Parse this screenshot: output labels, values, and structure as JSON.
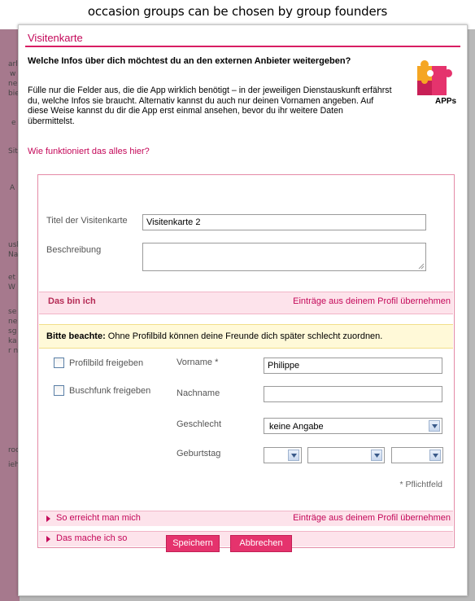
{
  "background": {
    "caption": "occasion groups can be chosen by group founders",
    "left_strip_texts": [
      "arl",
      "w",
      "nei",
      "bie",
      "e",
      "Site",
      "A",
      "usl",
      "Na",
      "et",
      "W",
      "se",
      "ne",
      "sg",
      "ka",
      "r n",
      "roc",
      "ieh"
    ],
    "accent_color": "#9a4f6f"
  },
  "dialog": {
    "title": "Visitenkarte",
    "heading": "Welche Infos über dich möchtest du an den externen Anbieter weitergeben?",
    "intro": "Fülle nur die Felder aus, die die App wirklich benötigt – in der jeweiligen Dienstauskunft erfährst du, welche Infos sie braucht. Alternativ kannst du auch nur deinen Vornamen angeben. Auf diese Weise kannst du dir die App erst einmal ansehen, bevor du ihr weitere Daten übermittelst.",
    "help_link": "Wie funktioniert das alles hier?",
    "logo": {
      "icon": "puzzle-icon",
      "label": "APPs"
    },
    "accent_color": "#d81d63"
  },
  "card": {
    "title_label": "Titel der Visitenkarte",
    "title_value": "Visitenkarte 2",
    "description_label": "Beschreibung",
    "description_value": ""
  },
  "about": {
    "section_title": "Das bin ich",
    "import_link": "Einträge aus deinem Profil übernehmen",
    "note_bold": "Bitte beachte:",
    "note_text": " Ohne Profilbild können deine Freunde dich später schlecht zuordnen.",
    "share_photo_label": "Profilbild freigeben",
    "share_photo_checked": false,
    "share_buschfunk_label": "Buschfunk freigeben",
    "share_buschfunk_checked": false,
    "firstname_label": "Vorname *",
    "firstname_value": "Philippe",
    "lastname_label": "Nachname",
    "lastname_value": "",
    "gender_label": "Geschlecht",
    "gender_value": "keine Angabe",
    "birthday_label": "Geburtstag",
    "birthday_day": "",
    "birthday_month": "",
    "birthday_year": "",
    "required_note": "* Pflichtfeld"
  },
  "reach": {
    "title": "So erreicht man mich",
    "import_link": "Einträge aus deinem Profil übernehmen"
  },
  "doing": {
    "title": "Das mache ich so"
  },
  "buttons": {
    "save": "Speichern",
    "cancel": "Abbrechen",
    "color": "#e5336d"
  }
}
